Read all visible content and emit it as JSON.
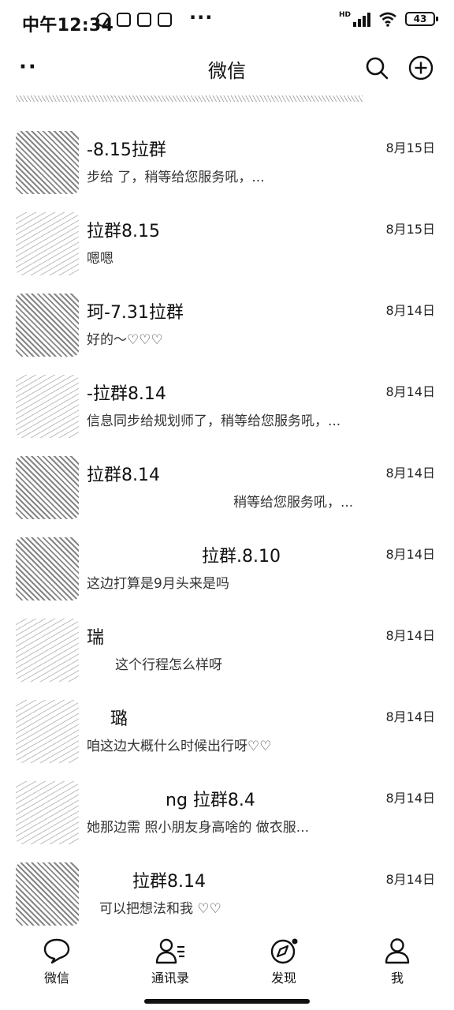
{
  "status_bar": {
    "time": "中午12:34",
    "more": "···",
    "network": "HD",
    "battery": "43"
  },
  "nav": {
    "more": "··",
    "title": "微信"
  },
  "chats": [
    {
      "name": "-8.15拉群",
      "preview": "步给 了，稍等给您服务吼，...",
      "date": "8月15日"
    },
    {
      "name": "拉群8.15",
      "preview": "嗯嗯",
      "date": "8月15日"
    },
    {
      "name": "珂-7.31拉群",
      "preview": "好的～♡♡♡",
      "date": "8月14日"
    },
    {
      "name": "-拉群8.14",
      "preview": "信息同步给规划师了，稍等给您服务吼，...",
      "date": "8月14日"
    },
    {
      "name": "拉群8.14",
      "preview": "稍等给您服务吼，...",
      "date": "8月14日"
    },
    {
      "name": "拉群.8.10",
      "preview": "这边打算是9月头来是吗",
      "date": "8月14日"
    },
    {
      "name": "瑞",
      "preview": "这个行程怎么样呀",
      "date": "8月14日"
    },
    {
      "name": "璐",
      "preview": "咱这边大概什么时候出行呀♡♡",
      "date": "8月14日"
    },
    {
      "name": "ng 拉群8.4",
      "preview": "她那边需 照小朋友身高啥的 做衣服...",
      "date": "8月14日"
    },
    {
      "name": "拉群8.14",
      "preview": "可以把想法和我 ♡♡",
      "date": "8月14日"
    }
  ],
  "tabs": [
    {
      "label": "微信",
      "icon": "chat-icon"
    },
    {
      "label": "通讯录",
      "icon": "contacts-icon"
    },
    {
      "label": "发现",
      "icon": "compass-icon"
    },
    {
      "label": "我",
      "icon": "person-icon"
    }
  ]
}
